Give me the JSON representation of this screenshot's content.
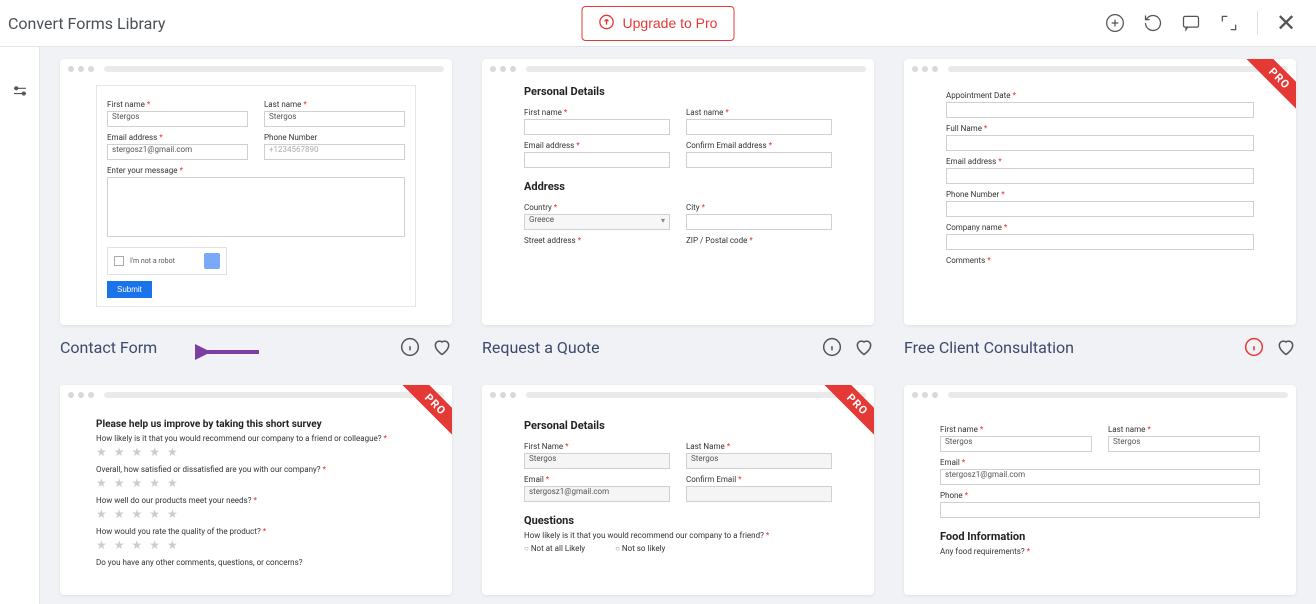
{
  "header": {
    "title": "Convert Forms Library",
    "upgrade": "Upgrade to Pro"
  },
  "ribbon": "PRO",
  "cards": [
    {
      "title": "Contact Form",
      "info_red": false,
      "form": {
        "first_name_label": "First name",
        "first_name_value": "Stergos",
        "last_name_label": "Last name",
        "last_name_value": "Stergos",
        "email_label": "Email address",
        "email_value": "stergosz1@gmail.com",
        "phone_label": "Phone Number",
        "phone_value": "+1234567890",
        "message_label": "Enter your message",
        "captcha": "I'm not a robot",
        "submit": "Submit"
      }
    },
    {
      "title": "Request a Quote",
      "info_red": false,
      "form": {
        "section1": "Personal Details",
        "first_name_label": "First name",
        "last_name_label": "Last name",
        "email_label": "Email address",
        "confirm_email_label": "Confirm Email address",
        "section2": "Address",
        "country_label": "Country",
        "country_value": "Greece",
        "city_label": "City",
        "street_label": "Street address",
        "zip_label": "ZIP / Postal code"
      }
    },
    {
      "title": "Free Client Consultation",
      "info_red": true,
      "form": {
        "appt_label": "Appointment Date",
        "fullname_label": "Full Name",
        "email_label": "Email address",
        "phone_label": "Phone Number",
        "company_label": "Company name",
        "comments_label": "Comments"
      }
    },
    {
      "title": "",
      "form": {
        "heading": "Please help us improve by taking this short survey",
        "q1": "How likely is it that you would recommend our company to a friend or colleague?",
        "q2": "Overall, how satisfied or dissatisfied are you with our company?",
        "q3": "How well do our products meet your needs?",
        "q4": "How would you rate the quality of the product?",
        "q5": "Do you have any other comments, questions, or concerns?"
      }
    },
    {
      "title": "",
      "form": {
        "section1": "Personal Details",
        "first_name_label": "First Name",
        "first_name_value": "Stergos",
        "last_name_label": "Last Name",
        "last_name_value": "Stergos",
        "email_label": "Email",
        "email_value": "stergosz1@gmail.com",
        "confirm_email_label": "Confirm Email",
        "section2": "Questions",
        "q1": "How likely is it that you would recommend our company to a friend?",
        "opt1": "Not at all Likely",
        "opt2": "Not so likely"
      }
    },
    {
      "title": "",
      "form": {
        "first_name_label": "First name",
        "first_name_value": "Stergos",
        "last_name_label": "Last name",
        "last_name_value": "Stergos",
        "email_label": "Email",
        "email_value": "stergosz1@gmail.com",
        "phone_label": "Phone",
        "section2": "Food Information",
        "q1": "Any food requirements?"
      }
    }
  ]
}
